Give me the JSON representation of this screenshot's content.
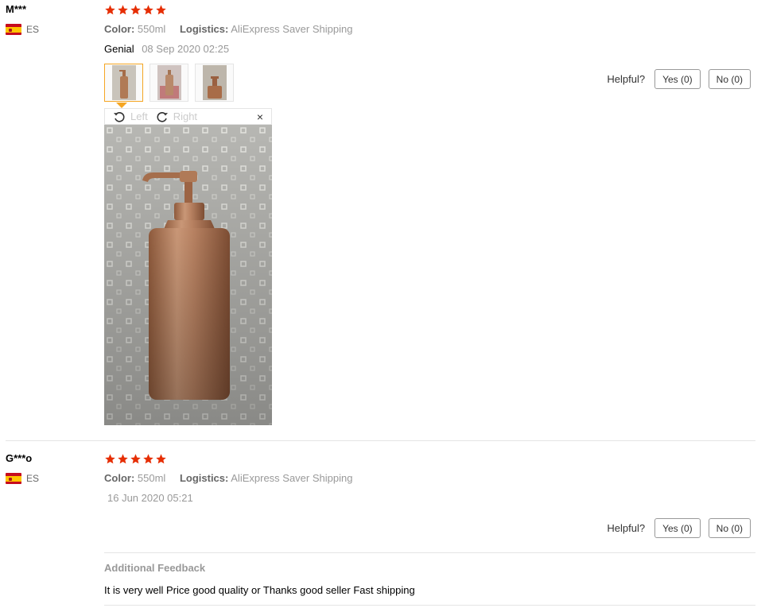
{
  "reviews": [
    {
      "user": "M***",
      "country": "ES",
      "rating": 5,
      "color_label": "Color:",
      "color_value": "550ml",
      "logistics_label": "Logistics:",
      "logistics_value": "AliExpress Saver Shipping",
      "feedback": "Genial",
      "date": "08 Sep 2020 02:25",
      "photos": [
        "photo-1",
        "photo-2",
        "photo-3"
      ],
      "viewer": {
        "left_label": "Left",
        "right_label": "Right",
        "close": "×"
      },
      "helpful": {
        "question": "Helpful?",
        "yes": "Yes (0)",
        "no": "No (0)"
      }
    },
    {
      "user": "G***o",
      "country": "ES",
      "rating": 5,
      "color_label": "Color:",
      "color_value": "550ml",
      "logistics_label": "Logistics:",
      "logistics_value": "AliExpress Saver Shipping",
      "feedback": "",
      "date": "16 Jun 2020 05:21",
      "helpful": {
        "question": "Helpful?",
        "yes": "Yes (0)",
        "no": "No (0)"
      },
      "additional_feedback_title": "Additional Feedback",
      "additional_feedback": "It is very well Price good quality or Thanks good seller Fast shipping"
    }
  ],
  "colors": {
    "star": "#e62e04",
    "accent": "#f5a623"
  }
}
